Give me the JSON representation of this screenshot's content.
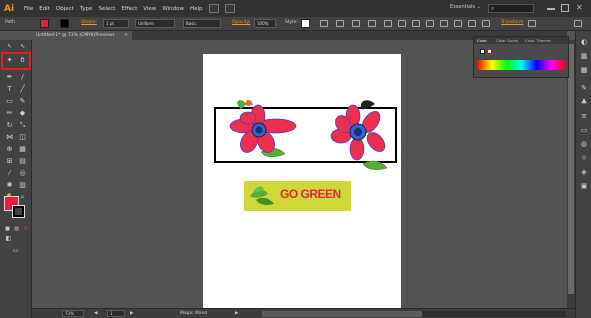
{
  "menubar": {
    "logo": "Ai",
    "items": [
      "File",
      "Edit",
      "Object",
      "Type",
      "Select",
      "Effect",
      "View",
      "Window",
      "Help"
    ],
    "workspace": "Essentials ⌄",
    "search_placeholder": ""
  },
  "controlbar": {
    "selection_label": "Path",
    "fill_color": "#ec1c3f",
    "stroke_label": "Stroke:",
    "stroke_weight": "1 pt",
    "profile": "Uniform",
    "brush": "Basic",
    "opacity_label": "Opacity:",
    "opacity_value": "100%",
    "style_label": "Style:",
    "transform_label": "Transform"
  },
  "document": {
    "tab_title": "Untitled-1* @ 73% (CMYK/Preview)",
    "tab_close": "×"
  },
  "artwork": {
    "banner_text": "GO GREEN",
    "banner_color": "#cfd838",
    "text_color": "#e2263d",
    "petal_color": "#ec2f4e",
    "leaf_color": "#5aab3a"
  },
  "statusbar": {
    "zoom": "73%",
    "page": "1",
    "active_tool": "Magic Wand"
  },
  "color_panel": {
    "tabs": [
      "Color",
      "Color Guide",
      "Color Themes"
    ]
  }
}
